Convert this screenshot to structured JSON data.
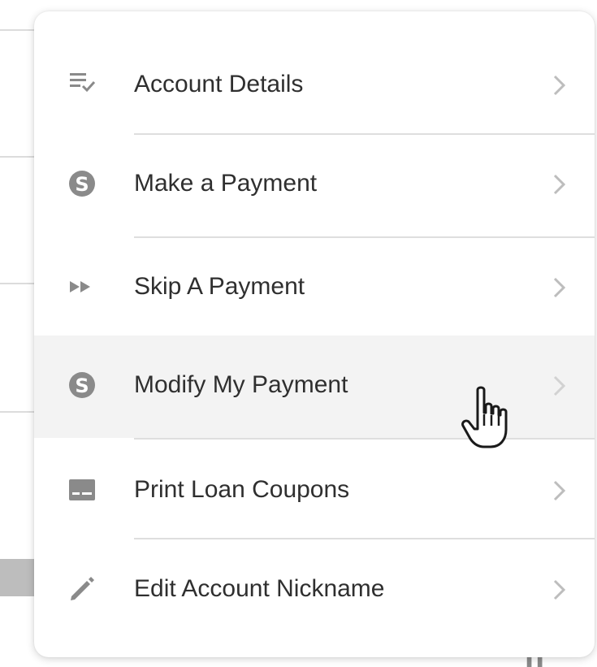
{
  "menu": {
    "items": [
      {
        "label": "Account Details",
        "icon": "list-check-icon"
      },
      {
        "label": "Make a Payment",
        "icon": "dollar-circle-icon"
      },
      {
        "label": "Skip A Payment",
        "icon": "fast-forward-icon"
      },
      {
        "label": "Modify My Payment",
        "icon": "dollar-circle-icon",
        "state": "hovered"
      },
      {
        "label": "Print Loan Coupons",
        "icon": "card-icon"
      },
      {
        "label": "Edit Account Nickname",
        "icon": "pencil-icon"
      }
    ]
  },
  "colors": {
    "icon": "#8a8a8a",
    "label": "#2f2f2f",
    "chevron": "#bdbdbd",
    "divider": "#dedede",
    "hover_background": "#f3f3f3"
  },
  "cursor": "hand-pointer-icon"
}
